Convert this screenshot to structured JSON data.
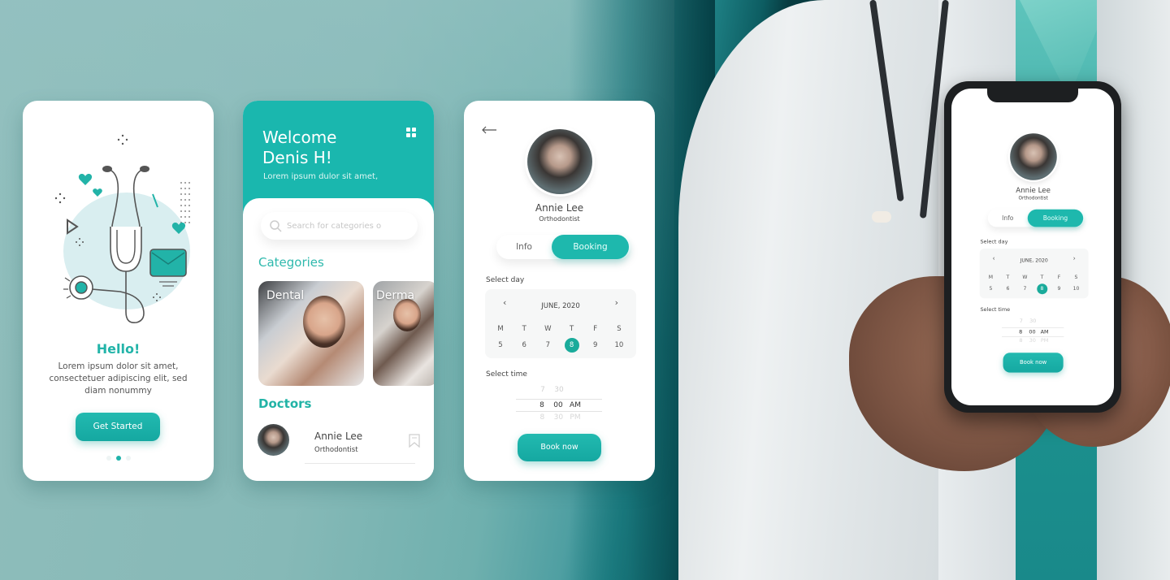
{
  "theme": {
    "accent": "#1fb3aa",
    "accent_dark": "#15a8a1",
    "selected_date": "#1aab9b",
    "background": "#8fbdbb",
    "background_dark": "#073b40"
  },
  "onboarding": {
    "title": "Hello!",
    "body": "Lorem ipsum dolor sit amet, consectetuer adipiscing elit, sed diam nonummy",
    "cta_label": "Get Started",
    "page_count": 3,
    "active_page": 2,
    "illustration": "stethoscope-illustration"
  },
  "home": {
    "greeting_line1": "Welcome",
    "greeting_line2": "Denis H!",
    "subtitle": "Lorem ipsum dulor sit amet,",
    "menu_icon": "grid-icon",
    "search_placeholder": "Search for categories o",
    "categories_title": "Categories",
    "categories": [
      {
        "label": "Dental"
      },
      {
        "label": "Derma"
      }
    ],
    "doctors_title": "Doctors",
    "doctors": [
      {
        "name": "Annie Lee",
        "specialty": "Orthodontist",
        "icon": "bookmark-icon"
      }
    ]
  },
  "booking": {
    "back_icon": "back-arrow-icon",
    "doctor_name": "Annie Lee",
    "doctor_specialty": "Orthodontist",
    "tabs": [
      {
        "label": "Info",
        "active": false
      },
      {
        "label": "Booking",
        "active": true
      }
    ],
    "select_day_label": "Select day",
    "month_label": "JUNE, 2020",
    "prev_icon": "‹",
    "next_icon": "›",
    "weekdays": [
      "M",
      "T",
      "W",
      "T",
      "F",
      "S"
    ],
    "dates": [
      "5",
      "6",
      "7",
      "8",
      "9",
      "10"
    ],
    "selected_date": "8",
    "select_time_label": "Select time",
    "time_rows": [
      {
        "hour": "7",
        "minute": "30",
        "period": ""
      },
      {
        "hour": "8",
        "minute": "00",
        "period": "AM"
      },
      {
        "hour": "8",
        "minute": "30",
        "period": "PM"
      }
    ],
    "cta_label": "Book now"
  }
}
